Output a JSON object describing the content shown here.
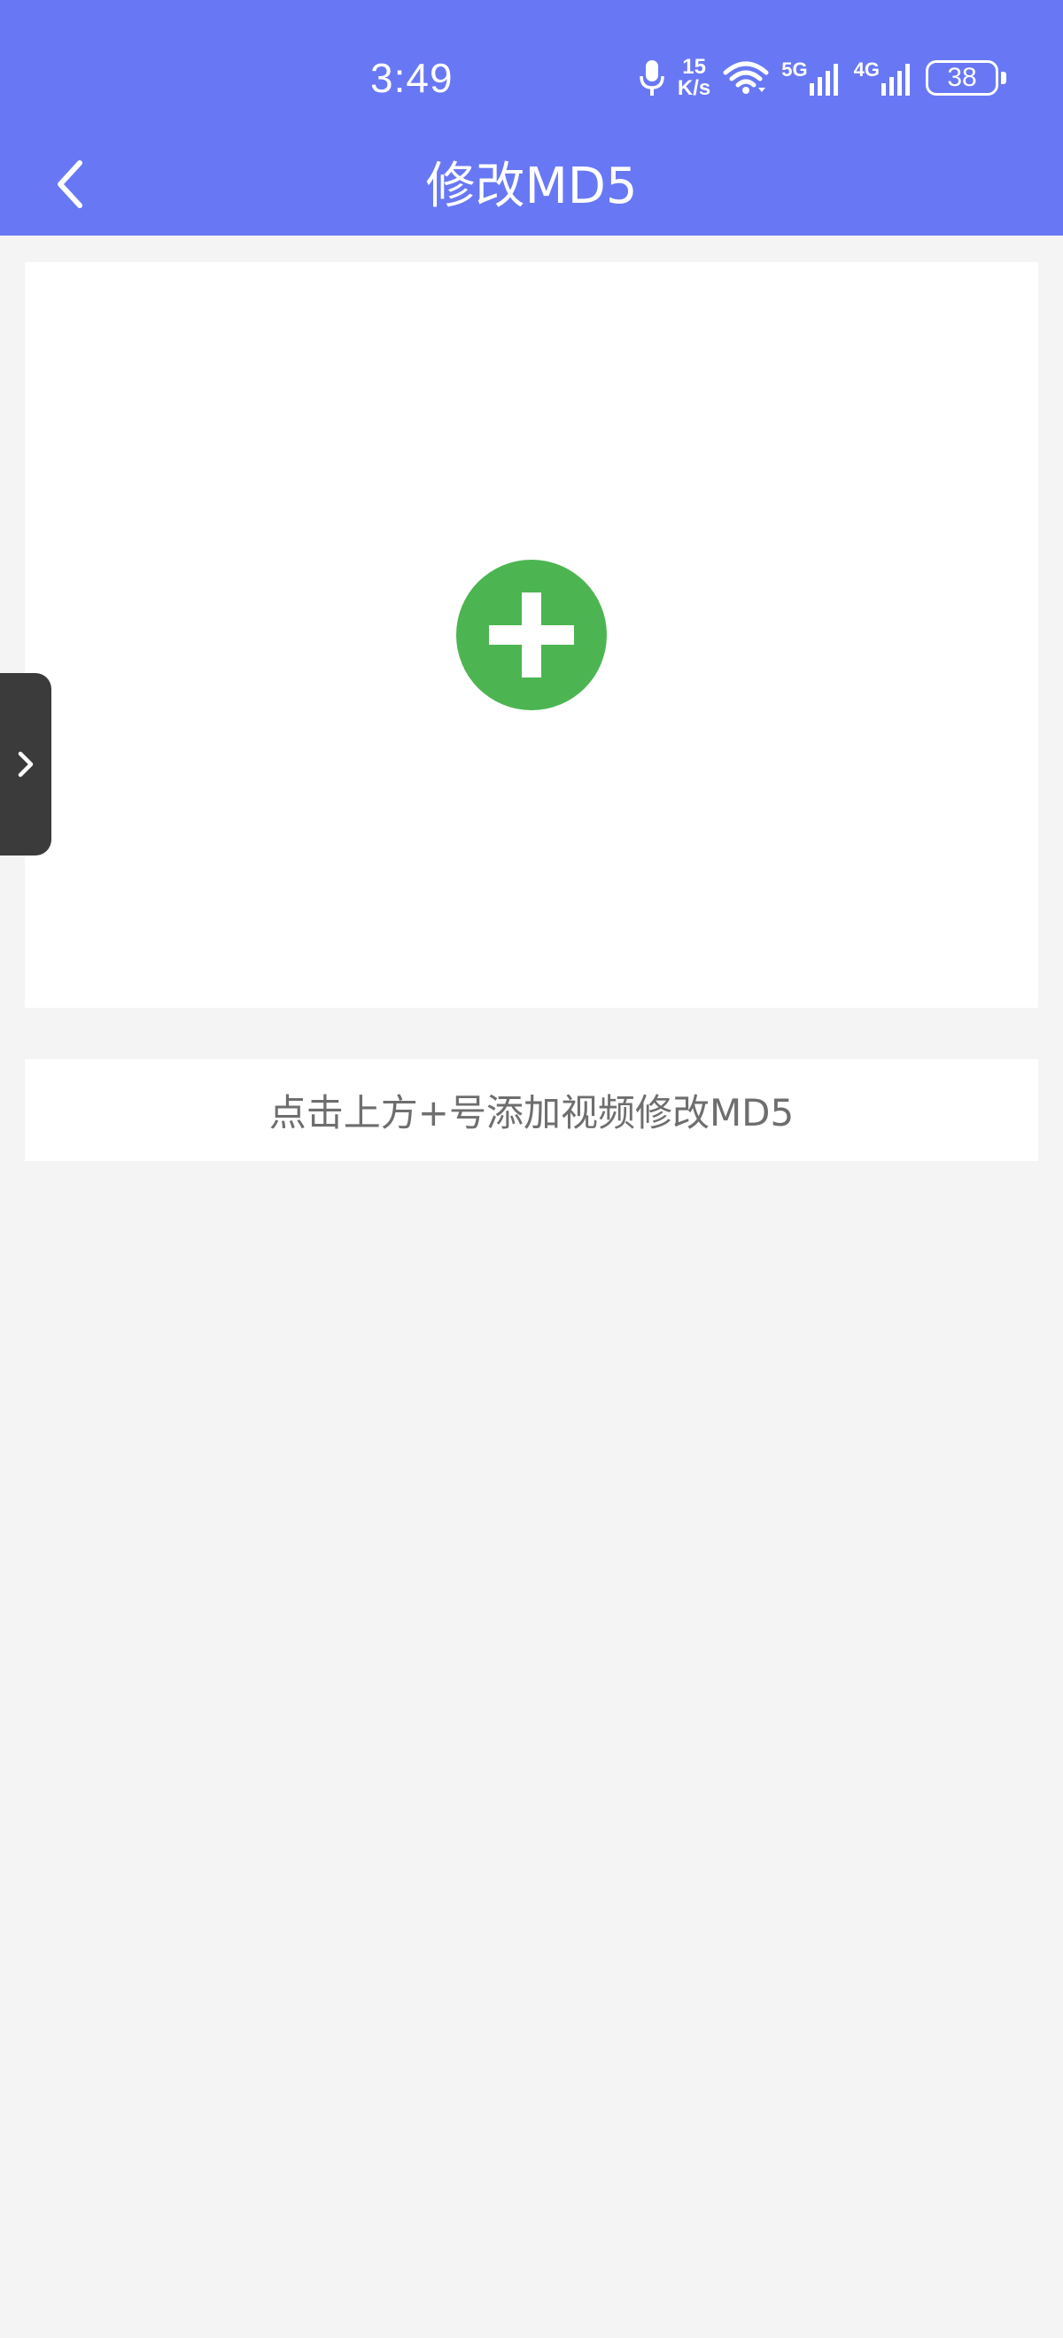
{
  "status_bar": {
    "time": "3:49",
    "net_speed_value": "15",
    "net_speed_unit": "K/s",
    "signal_1_label": "5G",
    "signal_2_label": "4G",
    "battery": "38",
    "icons": [
      "mic-icon",
      "wifi-icon",
      "signal-5g-icon",
      "signal-4g-icon",
      "battery-icon"
    ]
  },
  "title_bar": {
    "title": "修改MD5",
    "back_icon": "chevron-left-icon"
  },
  "upload": {
    "add_icon": "plus-circle-icon"
  },
  "side_handle": {
    "icon": "chevron-right-icon"
  },
  "hint": {
    "text": "点击上方+号添加视频修改MD5"
  },
  "colors": {
    "header": "#6878f4",
    "add_button": "#4cb551",
    "background": "#f4f4f4",
    "hint_text": "#6e6e6e",
    "side_handle": "#3b3b3b"
  }
}
